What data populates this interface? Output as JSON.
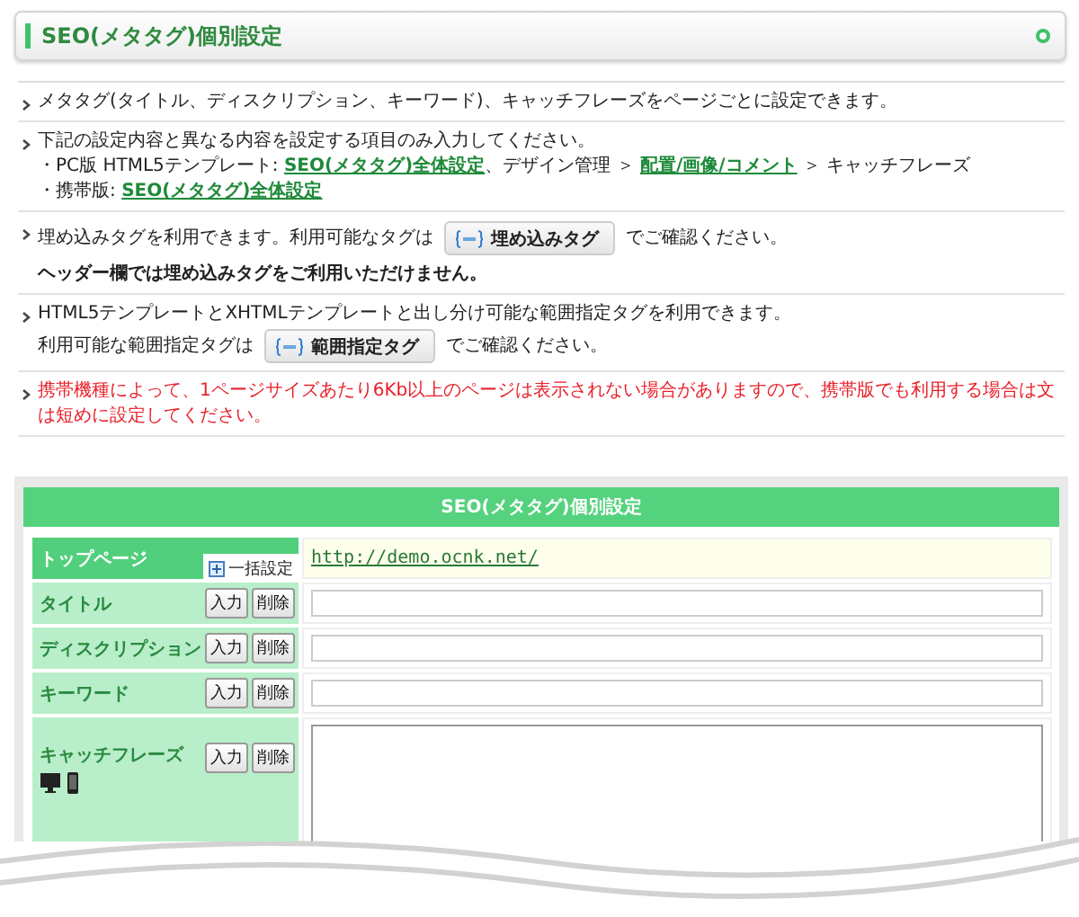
{
  "header": {
    "title": "SEO(メタタグ)個別設定"
  },
  "notes": [
    {
      "warning": false,
      "lines": [
        [
          {
            "kind": "text",
            "text": "メタタグ(タイトル、ディスクリプション、キーワード)、キャッチフレーズをページごとに設定できます。"
          }
        ]
      ]
    },
    {
      "warning": false,
      "lines": [
        [
          {
            "kind": "text",
            "text": "下記の設定内容と異なる内容を設定する項目のみ入力してください。"
          }
        ],
        [
          {
            "kind": "text",
            "text": "・PC版 HTML5テンプレート: "
          },
          {
            "kind": "link",
            "text": "SEO(メタタグ)全体設定"
          },
          {
            "kind": "text",
            "text": "、デザイン管理 ＞ "
          },
          {
            "kind": "link",
            "text": "配置/画像/コメント"
          },
          {
            "kind": "text",
            "text": " ＞ キャッチフレーズ"
          }
        ],
        [
          {
            "kind": "text",
            "text": "・携帯版: "
          },
          {
            "kind": "link",
            "text": "SEO(メタタグ)全体設定"
          }
        ]
      ]
    },
    {
      "warning": false,
      "lines": [
        [
          {
            "kind": "text",
            "text": "埋め込みタグを利用できます。利用可能なタグは"
          },
          {
            "kind": "tag",
            "text": "埋め込みタグ"
          },
          {
            "kind": "text",
            "text": "でご確認ください。"
          }
        ],
        [
          {
            "kind": "bold",
            "text": "ヘッダー欄では埋め込みタグをご利用いただけません。"
          }
        ]
      ]
    },
    {
      "warning": false,
      "lines": [
        [
          {
            "kind": "text",
            "text": "HTML5テンプレートとXHTMLテンプレートと出し分け可能な範囲指定タグを利用できます。"
          }
        ],
        [
          {
            "kind": "text",
            "text": "利用可能な範囲指定タグは"
          },
          {
            "kind": "tag",
            "text": "範囲指定タグ"
          },
          {
            "kind": "text",
            "text": "でご確認ください。"
          }
        ]
      ]
    },
    {
      "warning": true,
      "lines": [
        [
          {
            "kind": "text",
            "text": "携帯機種によって、1ページサイズあたり6Kb以上のページは表示されない場合がありますので、携帯版でも利用する場合は文は短めに設定してください。"
          }
        ]
      ]
    }
  ],
  "table": {
    "title": "SEO(メタタグ)個別設定",
    "rows": [
      {
        "kind": "url",
        "label": "トップページ",
        "bulk_button": "一括設定",
        "url": "http://demo.ocnk.net/"
      },
      {
        "kind": "input",
        "label": "タイトル",
        "buttons": [
          "入力",
          "削除"
        ]
      },
      {
        "kind": "input",
        "label": "ディスクリプション",
        "buttons": [
          "入力",
          "削除"
        ]
      },
      {
        "kind": "input",
        "label": "キーワード",
        "buttons": [
          "入力",
          "削除"
        ]
      },
      {
        "kind": "textarea",
        "label": "キャッチフレーズ",
        "buttons": [
          "入力",
          "削除"
        ],
        "devices": true
      }
    ]
  }
}
